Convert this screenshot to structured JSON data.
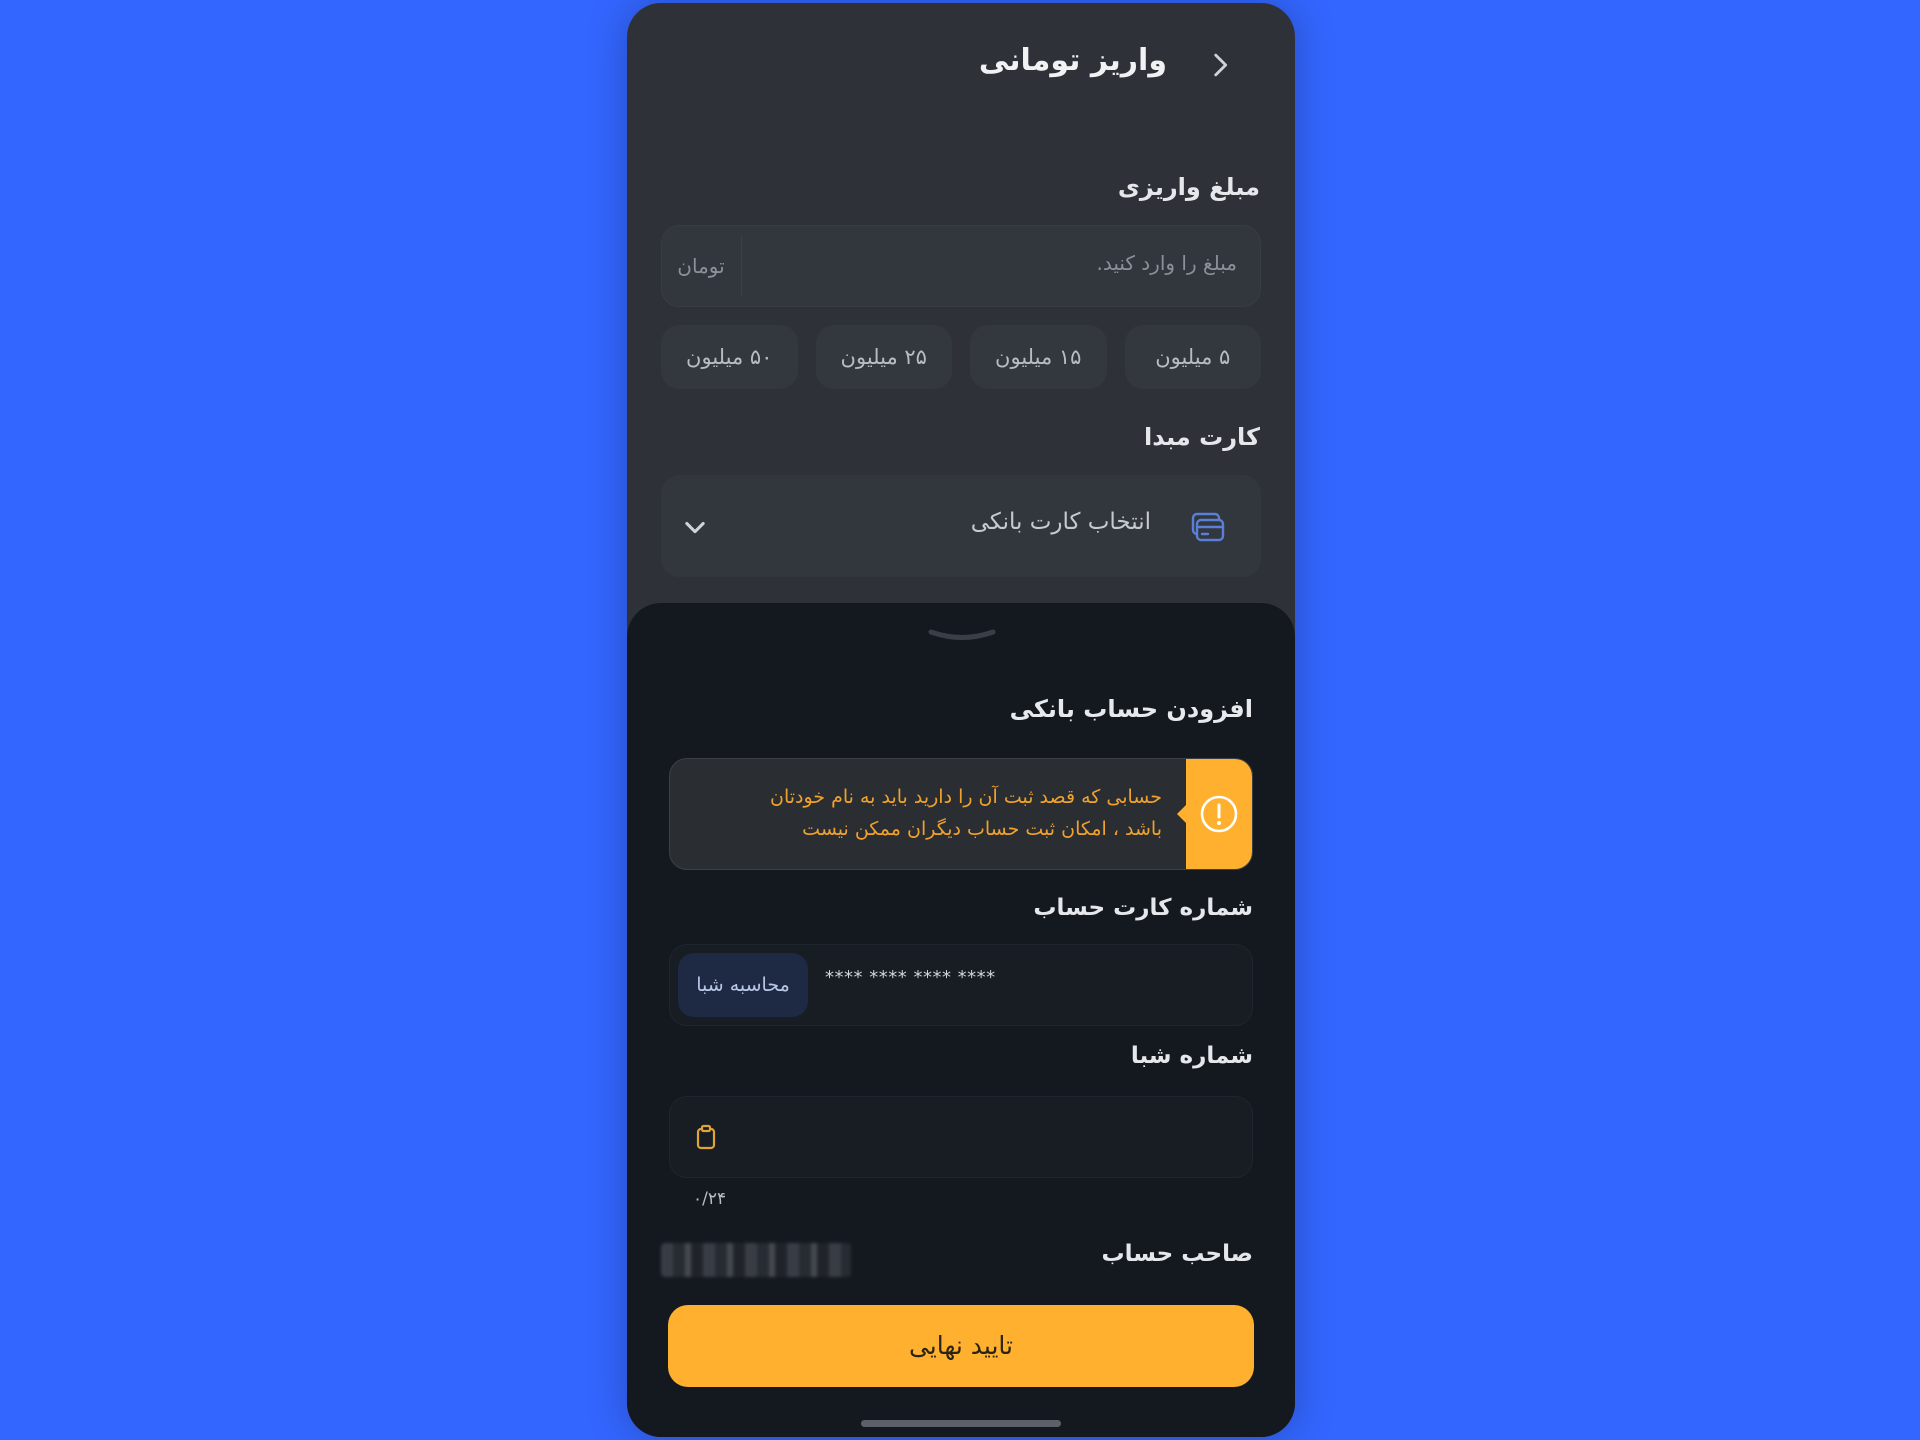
{
  "header": {
    "title": "واریز تومانی"
  },
  "deposit": {
    "amount_label": "مبلغ واریزی",
    "amount_placeholder": "مبلغ را وارد کنید.",
    "unit": "تومان",
    "quick_amounts": [
      "۵ میلیون",
      "۱۵ میلیون",
      "۲۵ میلیون",
      "۵۰ میلیون"
    ],
    "source_card_label": "کارت مبدا",
    "card_select_placeholder": "انتخاب کارت بانکی"
  },
  "sheet": {
    "title": "افزودن حساب بانکی",
    "warning_line1": "حسابی که قصد ثبت آن را دارید باید به نام خودتان",
    "warning_line2": "باشد ، امکان ثبت حساب دیگران ممکن نیست",
    "card_number_label": "شماره کارت حساب",
    "card_number_value": "**** **** **** ****",
    "shaba_calc_button": "محاسبه شبا",
    "shaba_label": "شماره شبا",
    "shaba_counter": "۰/۲۴",
    "owner_label": "صاحب حساب",
    "confirm_button": "تایید نهایی"
  },
  "colors": {
    "background": "#3366ff",
    "accent": "#ffb02e",
    "sheet_bg": "#141920",
    "screen_bg": "#2e3238"
  }
}
